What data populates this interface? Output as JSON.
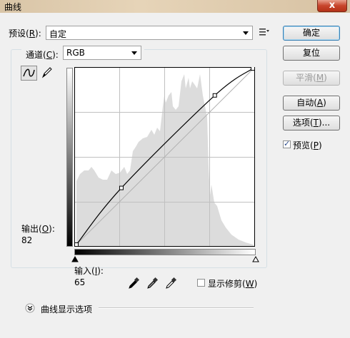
{
  "window": {
    "title": "曲线",
    "close_label": "x"
  },
  "preset": {
    "label": "预设(",
    "key": "R",
    "label_end": "):",
    "value": "自定",
    "menu_icon": "preset-options-icon"
  },
  "channel": {
    "label": "通道(",
    "key": "C",
    "label_end": "):",
    "value": "RGB"
  },
  "tools": {
    "curve_icon": "curve-tool-icon",
    "pencil_icon": "pencil-icon"
  },
  "output": {
    "label": "输出(",
    "key": "O",
    "label_end": "):",
    "value": "82"
  },
  "input": {
    "label": "输入(",
    "key": "I",
    "label_end": "):",
    "value": "65"
  },
  "eyedroppers": [
    "black-point-eyedropper-icon",
    "gray-point-eyedropper-icon",
    "white-point-eyedropper-icon"
  ],
  "show_clipping": {
    "label": "显示修剪(",
    "key": "W",
    "label_end": ")",
    "checked": false
  },
  "curve_options": {
    "label": "曲线显示选项",
    "icon": "expand-chevron-icon"
  },
  "buttons": {
    "ok": "确定",
    "reset": "复位",
    "smooth": "平滑(",
    "smooth_key": "M",
    "smooth_end": ")",
    "auto": "自动(",
    "auto_key": "A",
    "auto_end": ")",
    "options": "选项(",
    "options_key": "T",
    "options_end": ")..."
  },
  "preview": {
    "label": "预览(",
    "key": "P",
    "label_end": ")",
    "checked": true
  },
  "curve_points": [
    {
      "input": 0,
      "output": 0
    },
    {
      "input": 65,
      "output": 82
    },
    {
      "input": 200,
      "output": 216
    },
    {
      "input": 255,
      "output": 255
    }
  ]
}
